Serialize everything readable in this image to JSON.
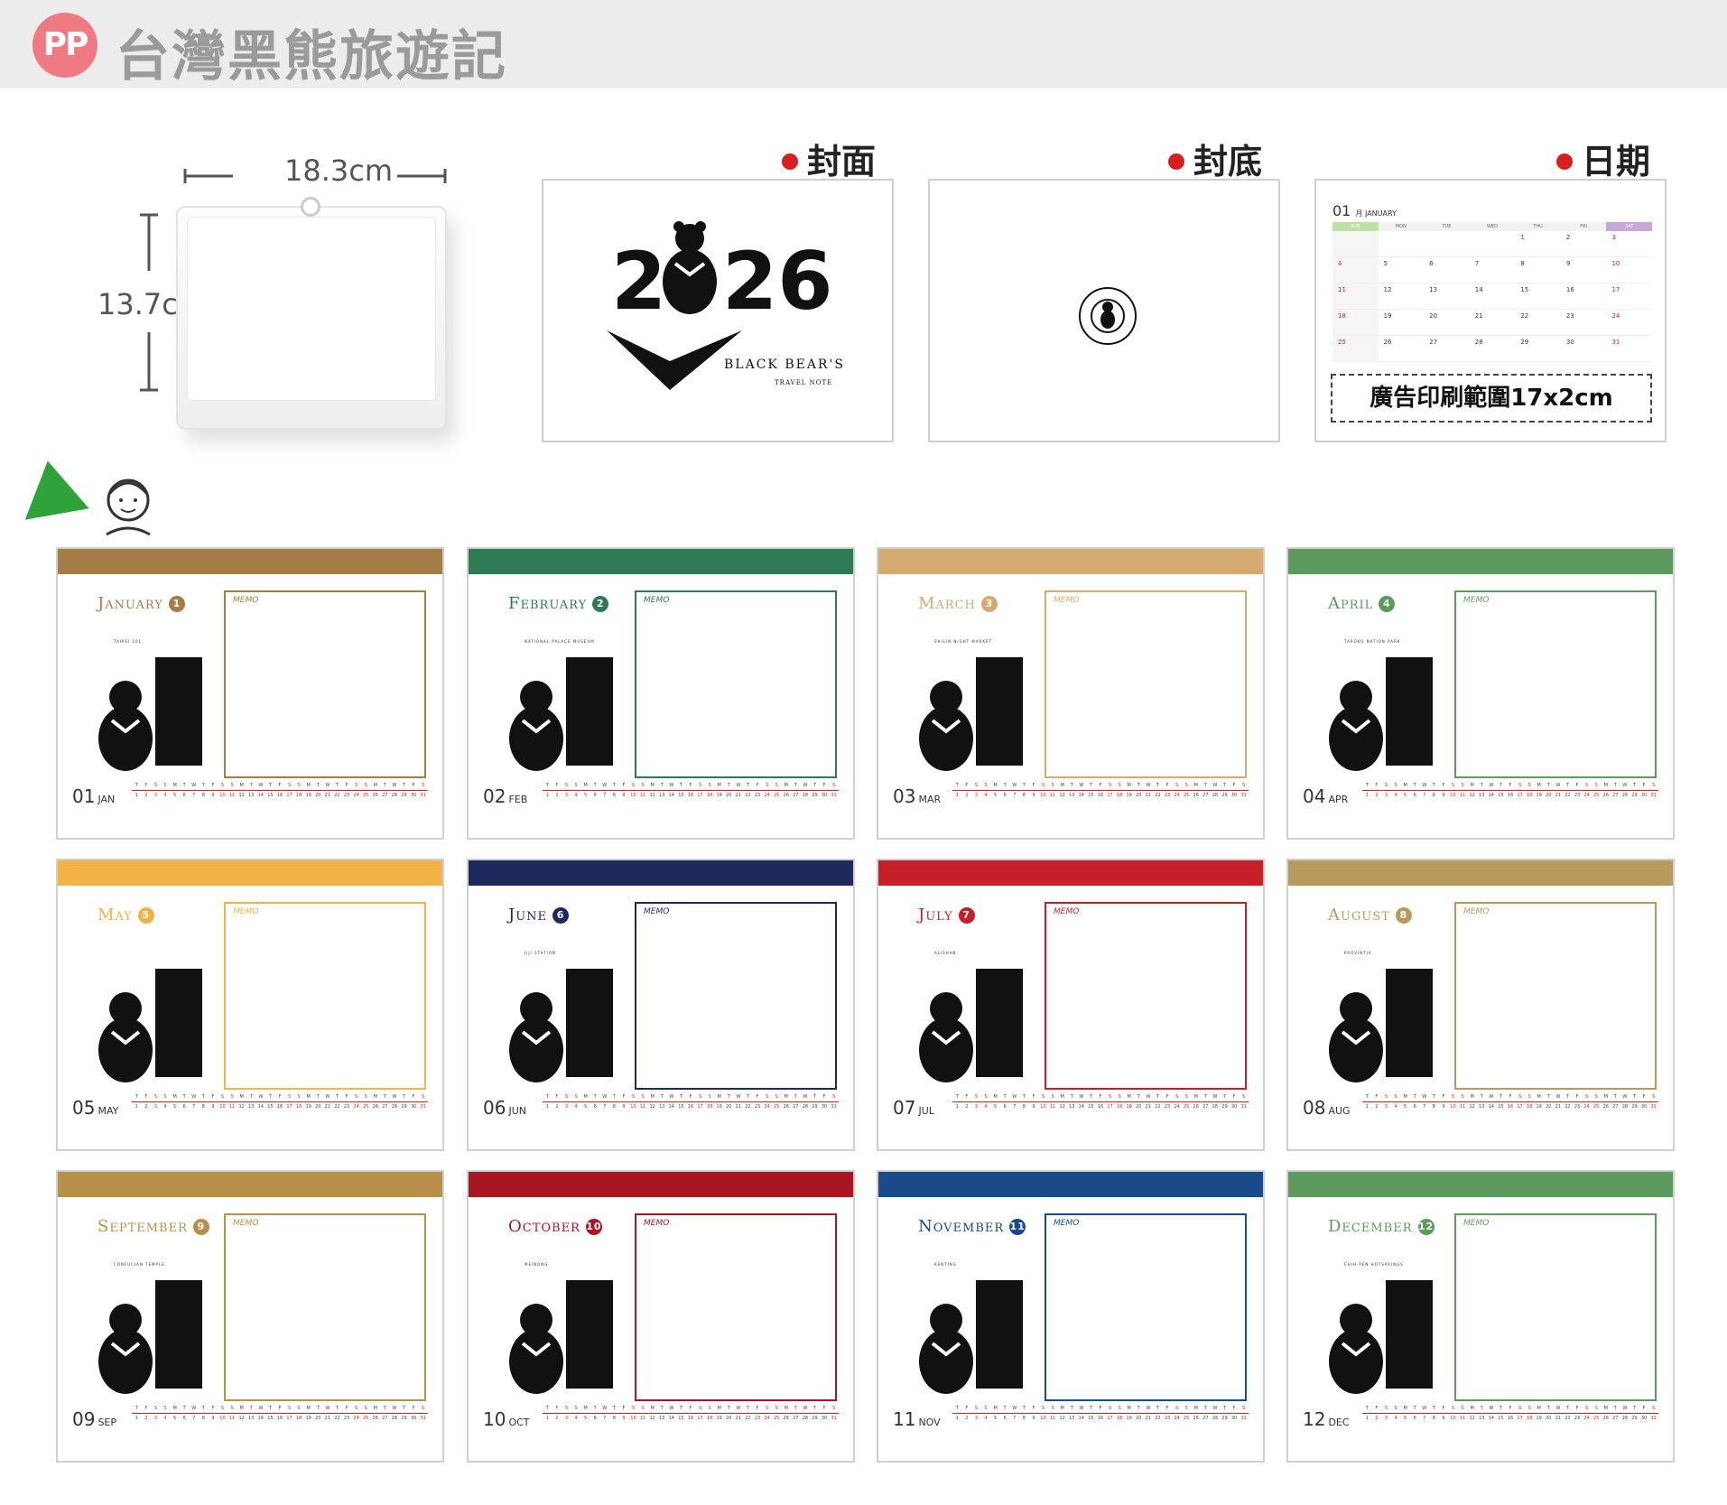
{
  "header": {
    "badge": "PP",
    "title": "台灣黑熊旅遊記"
  },
  "product": {
    "width_label": "18.3cm",
    "height_label": "13.7cm"
  },
  "previews": [
    {
      "label": "封面"
    },
    {
      "label": "封底"
    },
    {
      "label": "日期"
    }
  ],
  "cover": {
    "year_left": "2",
    "year_right": "26",
    "brand": "BLACK BEAR'S",
    "sub": "TRAVEL NOTE"
  },
  "date_preview": {
    "month_num": "01",
    "month_small": "月 JANUARY",
    "weekdays": [
      "SUN",
      "MON",
      "TUE",
      "WED",
      "THU",
      "FRI",
      "SAT"
    ],
    "weeks": [
      [
        "",
        "",
        "",
        "",
        "1",
        "2",
        "3"
      ],
      [
        "4",
        "5",
        "6",
        "7",
        "8",
        "9",
        "10"
      ],
      [
        "11",
        "12",
        "13",
        "14",
        "15",
        "16",
        "17"
      ],
      [
        "18",
        "19",
        "20",
        "21",
        "22",
        "23",
        "24"
      ],
      [
        "25",
        "26",
        "27",
        "28",
        "29",
        "30",
        "31"
      ]
    ],
    "ad_text": "廣告印刷範圍17x2cm"
  },
  "months": [
    {
      "name": "January",
      "num": "1",
      "place": "TAIPEI 101",
      "foot_num": "01",
      "foot_abbr": "JAN",
      "color": "#a57c45",
      "memo": "MEMO"
    },
    {
      "name": "February",
      "num": "2",
      "place": "NATIONAL PALACE MUSEUM",
      "foot_num": "02",
      "foot_abbr": "FEB",
      "color": "#2e7a55",
      "memo": "MEMO"
    },
    {
      "name": "March",
      "num": "3",
      "place": "SHILIN NIGHT MARKET",
      "foot_num": "03",
      "foot_abbr": "MAR",
      "color": "#d4aa70",
      "memo": "MEMO"
    },
    {
      "name": "April",
      "num": "4",
      "place": "TAROKO NATION PARK",
      "foot_num": "04",
      "foot_abbr": "APR",
      "color": "#5d9a5d",
      "memo": "MEMO"
    },
    {
      "name": "May",
      "num": "5",
      "place": "",
      "foot_num": "05",
      "foot_abbr": "MAY",
      "color": "#f2b245",
      "memo": "MEMO"
    },
    {
      "name": "June",
      "num": "6",
      "place": "JIJI STATION",
      "foot_num": "06",
      "foot_abbr": "JUN",
      "color": "#1e2a5e",
      "memo": "MEMO"
    },
    {
      "name": "July",
      "num": "7",
      "place": "ALISHAN",
      "foot_num": "07",
      "foot_abbr": "JUL",
      "color": "#c81e2a",
      "memo": "MEMO"
    },
    {
      "name": "August",
      "num": "8",
      "place": "PROVINTIA",
      "foot_num": "08",
      "foot_abbr": "AUG",
      "color": "#b89a5e",
      "memo": "MEMO"
    },
    {
      "name": "September",
      "num": "9",
      "place": "CONFUCIAN TEMPLE",
      "foot_num": "09",
      "foot_abbr": "SEP",
      "color": "#b89048",
      "memo": "MEMO"
    },
    {
      "name": "October",
      "num": "10",
      "place": "MEINONG",
      "foot_num": "10",
      "foot_abbr": "OCT",
      "color": "#a81622",
      "memo": "MEMO"
    },
    {
      "name": "November",
      "num": "11",
      "place": "KENTING",
      "foot_num": "11",
      "foot_abbr": "NOV",
      "color": "#1a4a8a",
      "memo": "MEMO"
    },
    {
      "name": "December",
      "num": "12",
      "place": "CHIH-PEN HOTSPRINGS",
      "foot_num": "12",
      "foot_abbr": "DEC",
      "color": "#5d9a5d",
      "memo": "MEMO"
    }
  ]
}
